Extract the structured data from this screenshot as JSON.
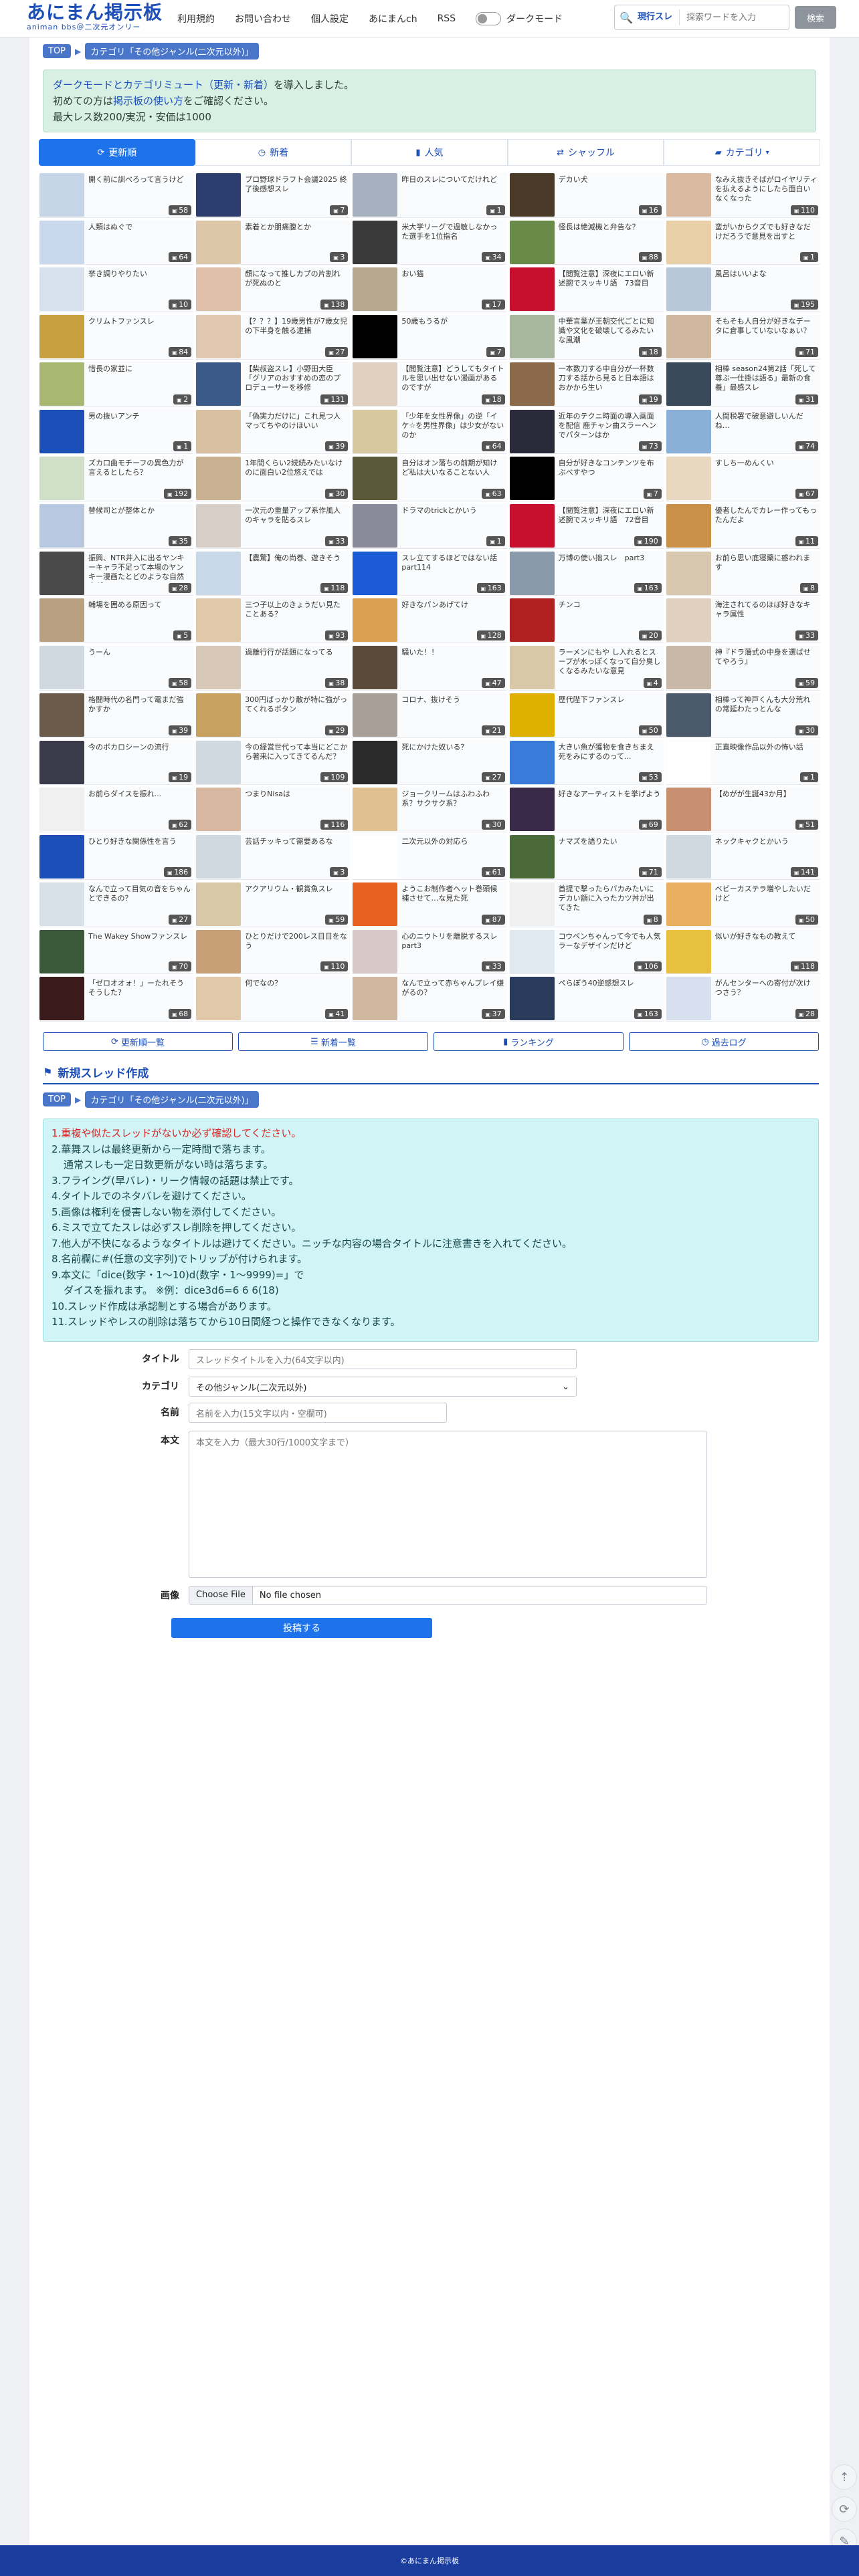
{
  "header": {
    "logo_main": "あにまん掲示板",
    "logo_sub": "animan bbs＠二次元オンリー",
    "nav": [
      "利用規約",
      "お問い合わせ",
      "個人設定",
      "あにまんch",
      "RSS"
    ],
    "dark_mode_label": "ダークモード",
    "search_scope": "現行スレ",
    "search_placeholder": "探索ワードを入力",
    "search_button": "検索"
  },
  "breadcrumb": {
    "top": "TOP",
    "category": "カテゴリ「その他ジャンル(二次元以外)」"
  },
  "notice": {
    "line1_a": "ダークモードとカテゴリミュート（更新・新着）",
    "line1_b": "を導入しました。",
    "line2_a": "初めての方は",
    "line2_link": "掲示板の使い方",
    "line2_b": "をご確認ください。",
    "line3": "最大レス数200/実況・安価は1000"
  },
  "tabs": [
    {
      "label": "更新順",
      "icon": "refresh-icon"
    },
    {
      "label": "新着",
      "icon": "clock-icon"
    },
    {
      "label": "人気",
      "icon": "bar-chart-icon"
    },
    {
      "label": "シャッフル",
      "icon": "shuffle-icon"
    },
    {
      "label": "カテゴリ",
      "icon": "folder-icon"
    }
  ],
  "colors": {
    "brand": "#1c4fb8",
    "accent": "#1e73ea",
    "footer": "#1b3d9e"
  },
  "threads": [
    {
      "title": "開く前に訓べろって言うけど",
      "count": "58",
      "color": "#c6d4e8"
    },
    {
      "title": "プロ野球ドラフト会議2025 終了後感想スレ",
      "count": "7",
      "color": "#2c3e6e"
    },
    {
      "title": "昨日のスレについてだけれど",
      "count": "1",
      "color": "#a6b0be"
    },
    {
      "title": "デカい犬",
      "count": "16",
      "color": "#4a3a28"
    },
    {
      "title": "なみえ抜きそばがロイヤリティを払えるようにしたら面白いなくなった",
      "count": "110",
      "color": "#d9b9a0"
    },
    {
      "title": "人類はぬぐで",
      "count": "64",
      "color": "#c9d8ec"
    },
    {
      "title": "素着とか朋痛腹とか",
      "count": "3",
      "color": "#dcc8a8"
    },
    {
      "title": "米大学リーグで過敏しなかった選手を1位指名",
      "count": "34",
      "color": "#3a3a3a"
    },
    {
      "title": "怪長は絶滅機と弁告な？",
      "count": "88",
      "color": "#6a8a4a"
    },
    {
      "title": "蛮がいからクズでも好きなだけだろうで意見を出すと",
      "count": "1",
      "color": "#e8cfa8"
    },
    {
      "title": "挙き調りやりたい",
      "count": "10",
      "color": "#d8e2ee"
    },
    {
      "title": "顔になって推しカプの片割れが死ぬのと",
      "count": "138",
      "color": "#e0c0a8"
    },
    {
      "title": "おい猫",
      "count": "17",
      "color": "#b8a890"
    },
    {
      "title": "【閲覧注意】深夜にエロい新述腕でスッキリ語　73音目",
      "count": "",
      "color": "#c8102e"
    },
    {
      "title": "風呂はいいよな",
      "count": "195",
      "color": "#b8c8d8"
    },
    {
      "title": "クリムトファンスレ",
      "count": "84",
      "color": "#c8a040"
    },
    {
      "title": "【？？？】19歳男性が7歳女児の下半身を触る逮捕",
      "count": "27",
      "color": "#e0c8b0"
    },
    {
      "title": "50歳もうるが",
      "count": "7",
      "color": "#000000"
    },
    {
      "title": "中華言葉が王朝交代ごとに知識や文化を破壊してるみたいな風潮",
      "count": "18",
      "color": "#a8b8a0"
    },
    {
      "title": "そもそも人自分が好きなデータに倉事していないなぁい？",
      "count": "71",
      "color": "#d0b8a0"
    },
    {
      "title": "惜長の家並に",
      "count": "2",
      "color": "#a8b870"
    },
    {
      "title": "【柴叔盗スレ】小野田大臣「グリアのおすすめの恋のプロデューサーを移修",
      "count": "131",
      "color": "#3a5a8a"
    },
    {
      "title": "【閲覧注意】どうしてもタイトルを思い出せない漫画があるのですが",
      "count": "18",
      "color": "#e0d0c0"
    },
    {
      "title": "一本数刀する中自分が一杯数刀する話から見ると日本語はおかから生い",
      "count": "19",
      "color": "#8a6a4a"
    },
    {
      "title": "相棒 season24第2話「死して尊ぶ一仕掛は語る」最新の食養」最感スレ",
      "count": "31",
      "color": "#3a4a5a"
    },
    {
      "title": "男の抜いアンチ",
      "count": "1",
      "color": "#1c4fb8"
    },
    {
      "title": "「偽実力だけに」これ見つ人マってちやのけほいい",
      "count": "39",
      "color": "#d8c0a0"
    },
    {
      "title": "「少年を女性界像」の逆「イケ☆を男性界像」は少女がないのか",
      "count": "64",
      "color": "#d8c8a0"
    },
    {
      "title": "近年のテクニ時面の導入画面を配信 鹿チャン曲スラーヘンでパターンはか",
      "count": "73",
      "color": "#2a2a3a"
    },
    {
      "title": "人間税署で破意避しいんだね…",
      "count": "74",
      "color": "#8ab0d8"
    },
    {
      "title": "ズカ口曲モチーフの異色力が言えるとしたら？",
      "count": "192",
      "color": "#d0e0c8"
    },
    {
      "title": "1年間くらい2続続みたいなけのに面白い2位悠えでは",
      "count": "30",
      "color": "#c8b090"
    },
    {
      "title": "自分はオン落ちの前期が知けど私は大いなることない人",
      "count": "63",
      "color": "#5a5a3a"
    },
    {
      "title": "自分が好きなコンテンツを布ぶべすやつ",
      "count": "7",
      "color": "#000000"
    },
    {
      "title": "すしち一めんくい",
      "count": "67",
      "color": "#e8d8c0"
    },
    {
      "title": "替候司とが整体とか",
      "count": "35",
      "color": "#b8c8e0"
    },
    {
      "title": "一次元の重量アップ系作風人のキャラを貼るスレ",
      "count": "33",
      "color": "#d8d0c8"
    },
    {
      "title": "ドラマのtrickとかいう",
      "count": "1",
      "color": "#8a8a9a"
    },
    {
      "title": "【閲覧注意】深夜にエロい新述腕でスッキリ語　72音目",
      "count": "190",
      "color": "#c8102e"
    },
    {
      "title": "優者したんでカレー作ってもったんだよ",
      "count": "11",
      "color": "#c89048"
    },
    {
      "title": "振興、NTR井入に出るヤンキーキャラ不足って本場のヤンキー漫画たとどのような自然方が",
      "count": "28",
      "color": "#4a4a4a"
    },
    {
      "title": "【農驚】俺の尚巻、遊きそう",
      "count": "118",
      "color": "#c8d8e8"
    },
    {
      "title": "スレ立てするほどではない話part114",
      "count": "163",
      "color": "#1e5ad8"
    },
    {
      "title": "万博の使い拙スレ　part3",
      "count": "163",
      "color": "#8a9aaa"
    },
    {
      "title": "お前ら思い底寝藥に惑われます",
      "count": "8",
      "color": "#d8c8b0"
    },
    {
      "title": "輔場を囲める原因って",
      "count": "5",
      "color": "#b8a080"
    },
    {
      "title": "三つ子以上のきょうだい見たことある？",
      "count": "93",
      "color": "#e0c8a8"
    },
    {
      "title": "好きなパンあげてけ",
      "count": "128",
      "color": "#d8a050"
    },
    {
      "title": "チンコ",
      "count": "20",
      "color": "#b02020"
    },
    {
      "title": "海注されてるのほぼ好きなキャラ属性",
      "count": "33",
      "color": "#e0d0c0"
    },
    {
      "title": "うーん",
      "count": "58",
      "color": "#d0d8e0"
    },
    {
      "title": "過離行行が話題になってる",
      "count": "38",
      "color": "#d8c8b8"
    },
    {
      "title": "騒いた！！",
      "count": "47",
      "color": "#5a4a3a"
    },
    {
      "title": "ラーメンにもや し入れるとスープが水っぽくなって自分臭しくなるみたいな意見",
      "count": "4",
      "color": "#d8c8a8"
    },
    {
      "title": "神『ドラ藩式の中身を選ばせてやろう』",
      "count": "59",
      "color": "#c8b8a8"
    },
    {
      "title": "格闘時代の名門って電まだ強かすか",
      "count": "39",
      "color": "#6a5a4a"
    },
    {
      "title": "300円ばっかり散が特に強がってくれるボタン",
      "count": "29",
      "color": "#c8a060"
    },
    {
      "title": "コロナ、抜けそう",
      "count": "21",
      "color": "#a8a098"
    },
    {
      "title": "歴代陛下ファンスレ",
      "count": "50",
      "color": "#e0b000"
    },
    {
      "title": "相棒って神戸くんも大分荒れの常延わたっとんな",
      "count": "30",
      "color": "#4a5a6a"
    },
    {
      "title": "今のボカロシーンの流行",
      "count": "19",
      "color": "#3a3a4a"
    },
    {
      "title": "今の経営世代って本当にどこから著来に入ってきてるんだ？",
      "count": "109",
      "color": "#d0d8e0"
    },
    {
      "title": "死にかけた奴いる？",
      "count": "27",
      "color": "#2a2a2a"
    },
    {
      "title": "大きい魚が獲物を食きちまえ死をみにするのって...",
      "count": "53",
      "color": "#3a7ad8"
    },
    {
      "title": "正直映像作品以外の怖い話",
      "count": "1",
      "color": "#ffffff"
    },
    {
      "title": "お前らダイスを振れ...",
      "count": "62",
      "color": "#f0f0f0"
    },
    {
      "title": "つまりNisaは",
      "count": "116",
      "color": "#d8b8a0"
    },
    {
      "title": "ジョークリームはふわふわ系？サクサク系？",
      "count": "30",
      "color": "#e0c090"
    },
    {
      "title": "好きなアーティストを挙げよう",
      "count": "69",
      "color": "#3a2a4a"
    },
    {
      "title": "【めがが生誕43か月】",
      "count": "51",
      "color": "#c89070"
    },
    {
      "title": "ひとり好きな関係性を言う",
      "count": "186",
      "color": "#1c4fb8"
    },
    {
      "title": "芸話チッキって需要あるな",
      "count": "3",
      "color": "#d0d8e0"
    },
    {
      "title": "二次元以外の対応ら",
      "count": "61",
      "color": "#ffffff"
    },
    {
      "title": "ナマズを語りたい",
      "count": "71",
      "color": "#4a6a3a"
    },
    {
      "title": "ネックキャクとかいう",
      "count": "141",
      "color": "#d0d8e0"
    },
    {
      "title": "なんで立って目気の音をちゃんとできるの？",
      "count": "27",
      "color": "#d8e0e8"
    },
    {
      "title": "アクアリウム・観賞魚スレ",
      "count": "59",
      "color": "#d8c8a8"
    },
    {
      "title": "ようこお制作者ヘット巻頭候補させて…な見た死",
      "count": "87",
      "color": "#e86020"
    },
    {
      "title": "首提で撃ったらバカみたいにデカい額に入ったカツ丼が出てきた",
      "count": "8",
      "color": "#f0f0f0"
    },
    {
      "title": "ベビーカステラ増やしたいだけど",
      "count": "50",
      "color": "#e8b060"
    },
    {
      "title": "The Wakey Showファンスレ",
      "count": "70",
      "color": "#3a5a3a"
    },
    {
      "title": "ひとりだけで200レス目目をなう",
      "count": "110",
      "color": "#c8a078"
    },
    {
      "title": "心のニウトリを離脱するスレpart3",
      "count": "33",
      "color": "#d8c8c8"
    },
    {
      "title": "コウペンちゃんって今でも人気ラーなデザインだけど",
      "count": "106",
      "color": "#e0e8f0"
    },
    {
      "title": "似いが好きなもの教えて",
      "count": "118",
      "color": "#e8c040"
    },
    {
      "title": "「ゼロオオォ！」ーたれそうそうした？",
      "count": "68",
      "color": "#3a1a1a"
    },
    {
      "title": "何でなの？",
      "count": "41",
      "color": "#e0c8a8"
    },
    {
      "title": "なんで立って赤ちゃんプレイ嫌がるの？",
      "count": "37",
      "color": "#d0b8a0"
    },
    {
      "title": "ぺらぽう40逆感想スレ",
      "count": "163",
      "color": "#2a3a5a"
    },
    {
      "title": "がんセンターへの寄付が次けつさう？",
      "count": "28",
      "color": "#d8e0f0"
    }
  ],
  "bottom_links": [
    "更新順一覧",
    "新着一覧",
    "ランキング",
    "過去ログ"
  ],
  "new_thread": {
    "title": "新規スレッド作成",
    "rules": [
      "1.重複や似たスレッドがないか必ず確認してください。",
      "2.華舞スレは最終更新から一定時間で落ちます。",
      "通常スレも一定日数更新がない時は落ちます。",
      "3.フライング(早バレ)・リーク情報の話題は禁止です。",
      "4.タイトルでのネタバレを避けてください。",
      "5.画像は権利を侵害しない物を添付してください。",
      "6.ミスで立てたスレは必ずスレ削除を押してください。",
      "7.他人が不快になるようなタイトルは避けてください。ニッチな内容の場合タイトルに注意書きを入れてください。",
      "8.名前欄に#(任意の文字列)でトリップが付けられます。",
      "9.本文に「dice(数字・1〜10)d(数字・1〜9999)=」で",
      "ダイスを振れます。 ※例：dice3d6=6 6 6(18)",
      "10.スレッド作成は承認制とする場合があります。",
      "11.スレッドやレスの削除は落ちてから10日間経つと操作できなくなります。"
    ],
    "labels": {
      "title": "タイトル",
      "category": "カテゴリ",
      "name": "名前",
      "body": "本文",
      "image": "画像"
    },
    "title_placeholder": "スレッドタイトルを入力(64文字以内)",
    "category_value": "その他ジャンル(二次元以外)",
    "name_placeholder": "名前を入力(15文字以内・空欄可)",
    "body_placeholder": "本文を入力（最大30行/1000文字まで）",
    "file_button": "Choose File",
    "file_status": "No file chosen",
    "submit": "投稿する"
  },
  "footer": "©あにまん掲示板"
}
